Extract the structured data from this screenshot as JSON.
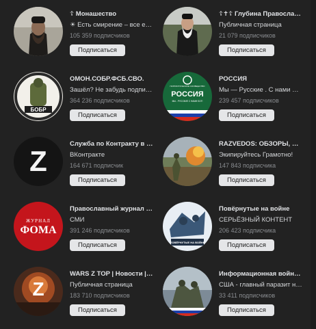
{
  "groups": [
    {
      "title": "☦ Монашество",
      "subtitle": "☀ Есть смирение – все есть...",
      "followers": "105 359 подписчиков",
      "button": "Подписаться"
    },
    {
      "title": "☦✝☦ Глубина Православия",
      "subtitle": "Публичная страница",
      "followers": "21 079 подписчиков",
      "button": "Подписаться"
    },
    {
      "title": "ОМОН.СОБР.ФСБ.СВО.",
      "subtitle": "Зашёл? Не забудь подписаться",
      "followers": "364 236 подписчиков",
      "button": "Подписаться"
    },
    {
      "title": "РОССИЯ",
      "subtitle": "Мы — Русские . С нами Бог !",
      "followers": "239 457 подписчиков",
      "button": "Подписаться"
    },
    {
      "title": "Служба по Контракту в ВС РФ",
      "subtitle": "ВКонтракте",
      "followers": "164 671 подписчик",
      "button": "Подписаться"
    },
    {
      "title": "RAZVEDOS: ОБЗОРЫ, АНАЛИТИКА",
      "subtitle": "Экипируйтесь Грамотно!",
      "followers": "147 843 подписчика",
      "button": "Подписаться"
    },
    {
      "title": "Православный журнал \"Фома\"",
      "subtitle": "СМИ",
      "followers": "391 246 подписчиков",
      "button": "Подписаться"
    },
    {
      "title": "Повёрнутые на войне",
      "subtitle": "СЕРЬЁЗНЫЙ КОНТЕНТ",
      "followers": "206 423 подписчика",
      "button": "Подписаться"
    },
    {
      "title": "WARS Z TOP | Новости | Россия",
      "subtitle": "Публичная страница",
      "followers": "183 710 подписчиков",
      "button": "Подписаться"
    },
    {
      "title": "Информационная война против",
      "subtitle": "США - главный паразит на планете",
      "followers": "33 411 подписчиков",
      "button": "Подписаться"
    }
  ],
  "avatar_text": {
    "bobr": "БОБР",
    "russia": "РОССИЯ",
    "russia_top": "ПАТРИОТИЧЕСКОЕ СООБЩЕСТВО",
    "russia_sub": "МЫ - РУССКИЕ С НАМИ БОГ!",
    "z": "Z",
    "foma_top": "ЖУРНАЛ",
    "foma": "ФОМА",
    "povernutye": "ПОВЁРНУТЫЕ НА ВОЙНЕ"
  },
  "colors": {
    "background": "#222222",
    "button_bg": "#e5e6e8",
    "title": "#e1e3e6",
    "muted": "#8a8d91"
  }
}
